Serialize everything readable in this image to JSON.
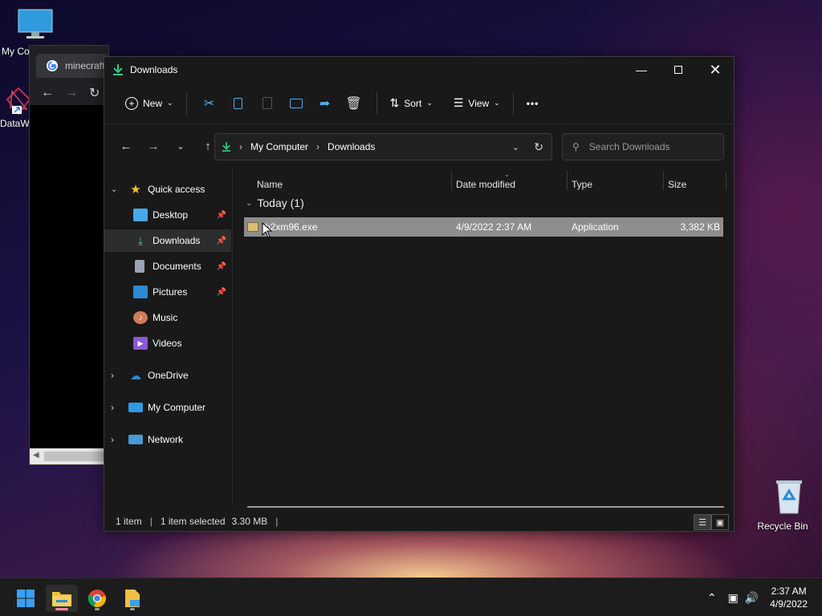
{
  "desktop": {
    "icons": [
      {
        "label": "My Co",
        "icon": "monitor-icon"
      },
      {
        "label": "DataW",
        "icon": "datawrapper-icon"
      },
      {
        "label": "Recycle Bin",
        "icon": "recycle-bin-icon"
      }
    ]
  },
  "chrome": {
    "tab_title": "minecraft"
  },
  "explorer": {
    "title": "Downloads",
    "commands": {
      "new": "New",
      "sort": "Sort",
      "view": "View",
      "more": "•••"
    },
    "breadcrumb": [
      "My Computer",
      "Downloads"
    ],
    "search_placeholder": "Search Downloads",
    "nav": {
      "quick_access": "Quick access",
      "items": [
        {
          "label": "Desktop",
          "pinned": true
        },
        {
          "label": "Downloads",
          "pinned": true,
          "selected": true
        },
        {
          "label": "Documents",
          "pinned": true
        },
        {
          "label": "Pictures",
          "pinned": true
        },
        {
          "label": "Music",
          "pinned": false
        },
        {
          "label": "Videos",
          "pinned": false
        }
      ],
      "onedrive": "OneDrive",
      "my_computer": "My Computer",
      "network": "Network"
    },
    "columns": {
      "name": "Name",
      "date": "Date modified",
      "type": "Type",
      "size": "Size"
    },
    "group": "Today (1)",
    "files": [
      {
        "name": "rb2xm96.exe",
        "date": "4/9/2022 2:37 AM",
        "type": "Application",
        "size": "3,382 KB"
      }
    ],
    "status": {
      "count": "1 item",
      "selected": "1 item selected",
      "size": "3.30 MB"
    }
  },
  "taskbar": {
    "time": "2:37 AM",
    "date": "4/9/2022"
  },
  "colors": {
    "accent": "#4cb0f0",
    "download_green": "#3cc48a",
    "selection": "#8e8e8e"
  }
}
